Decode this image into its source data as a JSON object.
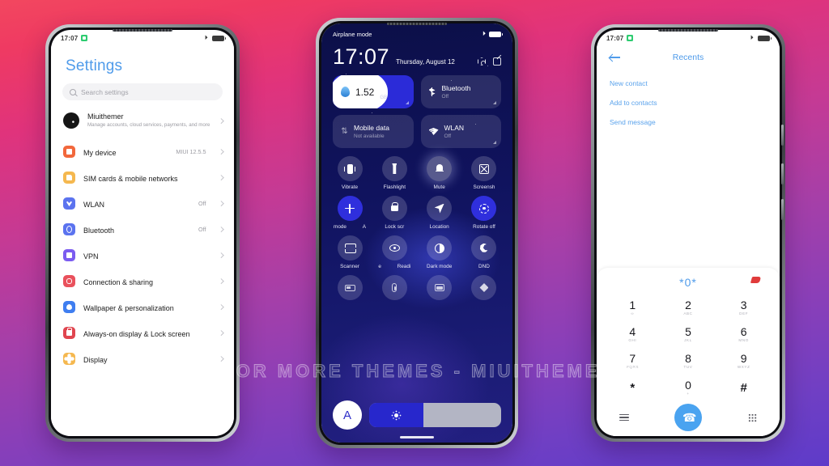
{
  "watermark": "VISIT FOR MORE THEMES - MIUITHEMER.COM",
  "theme": {
    "accent_blue": "#4f9bea",
    "cc_background": "#10135e",
    "cc_active": "#2f2fdd",
    "call_button": "#4aa3f0",
    "bg_gradient_start": "#f2475f",
    "bg_gradient_end": "#5e3bc9"
  },
  "phone1": {
    "status": {
      "time": "17:07",
      "icon": "sim-green-icon"
    },
    "title": "Settings",
    "search": {
      "placeholder": "Search settings",
      "icon": "search-icon"
    },
    "account": {
      "name": "Miuithemer",
      "subtitle": "Manage accounts, cloud services, payments, and more"
    },
    "items": [
      {
        "label": "My device",
        "value": "MIUI 12.5.5",
        "icon": "device-icon",
        "color": "#f2683c"
      },
      {
        "label": "SIM cards & mobile networks",
        "value": "",
        "icon": "sim-icon",
        "color": "#f5b84f"
      },
      {
        "label": "WLAN",
        "value": "Off",
        "icon": "wifi-icon",
        "color": "#5b73ef"
      },
      {
        "label": "Bluetooth",
        "value": "Off",
        "icon": "bluetooth-icon",
        "color": "#5b73ef"
      },
      {
        "label": "VPN",
        "value": "",
        "icon": "vpn-icon",
        "color": "#7b5cf0"
      },
      {
        "label": "Connection & sharing",
        "value": "",
        "icon": "link-icon",
        "color": "#e9515c"
      },
      {
        "label": "Wallpaper & personalization",
        "value": "",
        "icon": "droplet-icon",
        "color": "#3f7ef0"
      },
      {
        "label": "Always-on display & Lock screen",
        "value": "",
        "icon": "lock-icon",
        "color": "#e0454f"
      },
      {
        "label": "Display",
        "value": "",
        "icon": "brightness-icon",
        "color": "#f5b84f"
      }
    ]
  },
  "phone2": {
    "status": {
      "label": "Airplane mode"
    },
    "clock": "17:07",
    "date": "Thursday, August 12",
    "header_icons": [
      "settings-hex-icon",
      "edit-icon"
    ],
    "big_tiles": [
      {
        "type": "data-usage",
        "value": "1.52",
        "unit": "GB",
        "icon": "droplet-icon"
      },
      {
        "type": "toggle",
        "label": "Bluetooth",
        "sub": "Off",
        "icon": "bluetooth-icon"
      },
      {
        "type": "toggle",
        "label": "Mobile data",
        "sub": "Not available",
        "icon": "mobile-data-icon"
      },
      {
        "type": "toggle",
        "label": "WLAN",
        "sub": "Off",
        "icon": "wifi-icon"
      }
    ],
    "toggles": [
      {
        "label": "Vibrate",
        "icon": "vibrate-icon",
        "state": "off"
      },
      {
        "label": "Flashlight",
        "icon": "flashlight-icon",
        "state": "off"
      },
      {
        "label": "Mute",
        "icon": "bell-icon",
        "state": "highlight"
      },
      {
        "label": "Screensh",
        "icon": "screenshot-icon",
        "state": "off"
      },
      {
        "label_left": "mode",
        "label_right": "A",
        "label": "mode   A",
        "icon": "airplane-icon",
        "state": "on"
      },
      {
        "label": "Lock scr",
        "icon": "lock-icon",
        "state": "off"
      },
      {
        "label": "Location",
        "icon": "location-icon",
        "state": "off"
      },
      {
        "label": "Rotate off",
        "icon": "rotate-icon",
        "state": "on"
      },
      {
        "label": "Scanner",
        "icon": "scanner-icon",
        "state": "off"
      },
      {
        "label_left": "e",
        "label_right": "Readi",
        "label": "e   Readi",
        "icon": "reading-eye-icon",
        "state": "off"
      },
      {
        "label": "Dark mode",
        "icon": "contrast-icon",
        "state": "off"
      },
      {
        "label": "DND",
        "icon": "moon-icon",
        "state": "off"
      },
      {
        "label": "",
        "icon": "battery-saver-icon",
        "state": "off"
      },
      {
        "label": "",
        "icon": "battery-icon",
        "state": "off"
      },
      {
        "label": "",
        "icon": "cast-icon",
        "state": "off"
      },
      {
        "label": "",
        "icon": "theme-icon",
        "state": "off"
      }
    ],
    "brightness": {
      "auto_label": "A",
      "icon": "sun-icon",
      "fill_percent": 41
    }
  },
  "phone3": {
    "status": {
      "time": "17:07",
      "icon": "sim-green-icon"
    },
    "back_icon": "back-arrow-icon",
    "title": "Recents",
    "links": [
      "New contact",
      "Add to contacts",
      "Send message"
    ],
    "dial_number": "*0*",
    "delete_icon": "backspace-icon",
    "keys": [
      {
        "digit": "1",
        "letters": "∞"
      },
      {
        "digit": "2",
        "letters": "ABC"
      },
      {
        "digit": "3",
        "letters": "DEF"
      },
      {
        "digit": "4",
        "letters": "GHI"
      },
      {
        "digit": "5",
        "letters": "JKL"
      },
      {
        "digit": "6",
        "letters": "MNO"
      },
      {
        "digit": "7",
        "letters": "PQRS"
      },
      {
        "digit": "8",
        "letters": "TUV"
      },
      {
        "digit": "9",
        "letters": "WXYZ"
      },
      {
        "digit": "*",
        "letters": ""
      },
      {
        "digit": "0",
        "letters": "+"
      },
      {
        "digit": "#",
        "letters": ""
      }
    ],
    "actions": [
      "menu-icon",
      "call-button",
      "keypad-icon"
    ]
  }
}
